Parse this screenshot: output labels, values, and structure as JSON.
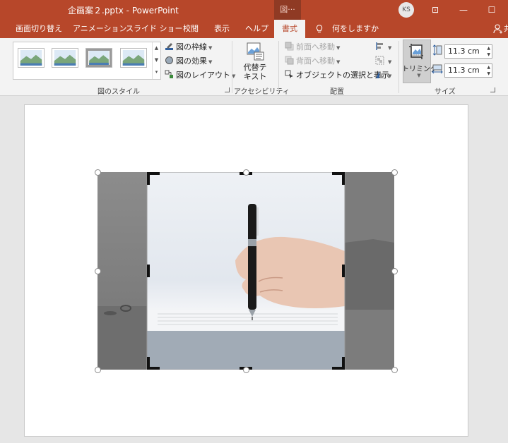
{
  "window": {
    "title": "企画案２.pptx  -  PowerPoint",
    "context_tab": "図···",
    "user_initials": "KS",
    "controls": {
      "ribbon_display": "⊡",
      "minimize": "—",
      "maximize": "☐"
    }
  },
  "tabs": [
    "画面切り替え",
    "アニメーション",
    "スライド ショー",
    "校閲",
    "表示",
    "ヘルプ",
    "書式"
  ],
  "active_tab": "書式",
  "tell_me": "何をしますか",
  "share_fragment": "共",
  "ribbon": {
    "styles_group": {
      "label": "図のスタイル",
      "border": "図の枠線",
      "effects": "図の効果",
      "layout": "図のレイアウト"
    },
    "accessibility_group": {
      "label": "アクセシビリティ",
      "alt_text_line1": "代替テ",
      "alt_text_line2": "キスト"
    },
    "arrange_group": {
      "label": "配置",
      "bring_forward": "前面へ移動",
      "send_backward": "背面へ移動",
      "selection_pane": "オブジェクトの選択と表示"
    },
    "size_group": {
      "label": "サイズ",
      "crop": "トリミング",
      "height_value": "11.3 cm",
      "width_value": "11.3 cm"
    }
  },
  "colors": {
    "accent": "#b7472a",
    "accent_dark": "#8f3a24",
    "ribbon_bg": "#f3f3f3"
  }
}
